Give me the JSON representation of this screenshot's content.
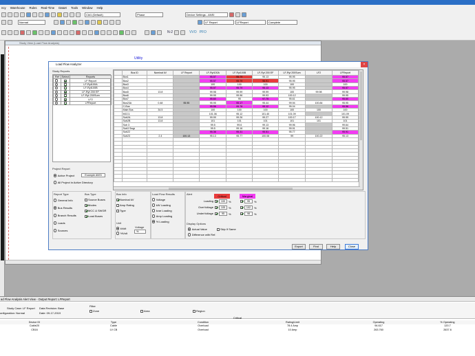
{
  "app": {
    "menu": [
      "ncy",
      "Warehouse",
      "Rules",
      "Real-Time",
      "DataX",
      "Tools",
      "Window",
      "Help"
    ],
    "toolbar": {
      "config_combo": "Ckt1 (Default)",
      "phase_combo": "Phase",
      "standard_combo": "Device Settings - ANSI",
      "normal_combo": "Normal",
      "lf_report_combo": "LF Report",
      "lf_report2_combo": "LFReport",
      "complete_combo": "Complete",
      "n2_label": "N-2",
      "vvo_label": "VVO",
      "pfo_label": "PFO"
    }
  },
  "overview": {
    "title": "Study View (Load Flow Analysis)",
    "utility_label": "Utility"
  },
  "dialog": {
    "title": "Load Flow Analyzer",
    "study_reports": {
      "label": "Study Reports",
      "headers": [
        "Ref",
        "Select",
        "Reports"
      ],
      "rows": [
        {
          "ref": false,
          "select": true,
          "name": "LF Report"
        },
        {
          "ref": false,
          "select": true,
          "name": "LF-Ryt100A"
        },
        {
          "ref": false,
          "select": true,
          "name": "LF-Ryt100B"
        },
        {
          "ref": false,
          "select": true,
          "name": "LF-Ryt 200 EF"
        },
        {
          "ref": false,
          "select": true,
          "name": "LF-Ryt 200Sum"
        },
        {
          "ref": false,
          "select": true,
          "name": "LF2"
        },
        {
          "ref": false,
          "select": true,
          "name": "LFReport"
        }
      ]
    },
    "project_report": {
      "label": "Project Report",
      "active_project": "Active Project",
      "project_name": "Example ANSI",
      "all_projects": "All Project in Active Directory"
    },
    "grid": {
      "headers": [
        "Bus ID",
        "Nominal kV",
        "LF Report",
        "LF-Ryt100A",
        "LF-Ryt100B",
        "LF-Ryt 200 EF",
        "LF-Ryt 200Sum",
        "LF2",
        "LFReport"
      ],
      "rows": [
        {
          "id": "Bus1",
          "kv": "",
          "c": [
            [
              "95.57",
              "pk"
            ],
            [
              "95.79",
              "rd"
            ],
            [
              "95.13",
              ""
            ],
            [
              "95.95",
              ""
            ],
            [
              "",
              ""
            ],
            [
              "95.57",
              "pk"
            ]
          ]
        },
        {
          "id": "Bus2",
          "kv": "",
          "c": [
            [
              "95.57",
              "pk"
            ],
            [
              "95.79",
              "rd"
            ],
            [
              "96.91",
              "rd"
            ],
            [
              "95.95",
              ""
            ],
            [
              "",
              ""
            ],
            [
              "95.57",
              "pk"
            ]
          ]
        },
        {
          "id": "Bus3",
          "kv": "",
          "c": [
            [
              "100",
              ""
            ],
            [
              "100",
              ""
            ],
            [
              "100",
              ""
            ],
            [
              "100",
              ""
            ],
            [
              "",
              ""
            ],
            [
              "100",
              ""
            ]
          ]
        },
        {
          "id": "Bus4",
          "kv": "",
          "c": [
            [
              "95.57",
              "pk"
            ],
            [
              "95.79",
              "pk"
            ],
            [
              "95.13",
              "pk"
            ],
            [
              "95.95",
              ""
            ],
            [
              "",
              ""
            ],
            [
              "95.57",
              "pk"
            ]
          ]
        },
        {
          "id": "Bus5",
          "kv": "13.8",
          "c": [
            [
              "99.98",
              ""
            ],
            [
              "99.99",
              ""
            ],
            [
              "99.99",
              ""
            ],
            [
              "100",
              ""
            ],
            [
              "99.98",
              ""
            ],
            [
              "99.98",
              ""
            ]
          ]
        },
        {
          "id": "Bus6",
          "kv": "",
          "c": [
            [
              "99.95",
              ""
            ],
            [
              "99.96",
              ""
            ],
            [
              "99.93",
              ""
            ],
            [
              "100.12",
              ""
            ],
            [
              "",
              ""
            ],
            [
              "99.95",
              ""
            ]
          ]
        },
        {
          "id": "Bus7",
          "kv": "",
          "c": [
            [
              "95.60",
              "pk"
            ],
            [
              "95",
              ""
            ],
            [
              "97.75",
              "pk"
            ],
            [
              "95.61",
              ""
            ],
            [
              "",
              ""
            ],
            [
              "95.60",
              "pk"
            ]
          ]
        },
        {
          "id": "Bus23A",
          "kv": "0.48",
          "c": [
            [
              "95.95",
              ""
            ],
            [
              "95.17",
              "pk"
            ],
            [
              "95.44",
              ""
            ],
            [
              "99.94",
              ""
            ],
            [
              "100.84",
              ""
            ],
            [
              "95.95",
              ""
            ]
          ]
        },
        {
          "id": "C-Bus",
          "kv": "",
          "c": [
            [
              "95.56",
              "pk"
            ],
            [
              "95.78",
              "pk"
            ],
            [
              "95.12",
              "pk"
            ],
            [
              "95.04",
              ""
            ],
            [
              "",
              ""
            ],
            [
              "95.56",
              "pk"
            ]
          ]
        },
        {
          "id": "Main Bus",
          "kv": "34.5",
          "c": [
            [
              "100",
              ""
            ],
            [
              "100",
              ""
            ],
            [
              "100",
              ""
            ],
            [
              "100",
              ""
            ],
            [
              "100",
              ""
            ],
            [
              "100",
              ""
            ]
          ]
        },
        {
          "id": "MCC1",
          "kv": "",
          "c": [
            [
              "101.06",
              ""
            ],
            [
              "95.12",
              ""
            ],
            [
              "101.40",
              ""
            ],
            [
              "101.09",
              ""
            ],
            [
              "",
              ""
            ],
            [
              "101.09",
              ""
            ]
          ]
        },
        {
          "id": "Sub2A",
          "kv": "13.8",
          "c": [
            [
              "99.99",
              ""
            ],
            [
              "99.26",
              ""
            ],
            [
              "99.27",
              ""
            ],
            [
              "100.17",
              ""
            ],
            [
              "100.12",
              ""
            ],
            [
              "99.99",
              ""
            ]
          ]
        },
        {
          "id": "Sub2B",
          "kv": "13.8",
          "c": [
            [
              "101",
              ""
            ],
            [
              "101",
              ""
            ],
            [
              "101",
              ""
            ],
            [
              "101",
              ""
            ],
            [
              "101",
              ""
            ],
            [
              "101",
              ""
            ]
          ]
        },
        {
          "id": "Sub 3",
          "kv": "",
          "c": [
            [
              "99.5",
              ""
            ],
            [
              "99.6",
              ""
            ],
            [
              "99.13",
              ""
            ],
            [
              "99.96",
              ""
            ],
            [
              "",
              ""
            ],
            [
              "99.64",
              ""
            ]
          ]
        },
        {
          "id": "Sub3 Swgr",
          "kv": "",
          "c": [
            [
              "99.5",
              ""
            ],
            [
              "99.16",
              ""
            ],
            [
              "99.16",
              ""
            ],
            [
              "99.91",
              ""
            ],
            [
              "",
              ""
            ],
            [
              "99.51",
              ""
            ]
          ]
        },
        {
          "id": "Sub22",
          "kv": "",
          "c": [
            [
              "95.36",
              "pk"
            ],
            [
              "95.31",
              "pk"
            ],
            [
              "95.51",
              "pk"
            ],
            [
              "95.77",
              ""
            ],
            [
              "",
              ""
            ],
            [
              "95.91",
              "pk"
            ]
          ]
        },
        {
          "id": "Sub23",
          "kv": "2.4",
          "c": [
            [
              "95.13",
              ""
            ],
            [
              "95.77",
              ""
            ],
            [
              "100.08",
              ""
            ],
            [
              "99",
              ""
            ],
            [
              "100.22",
              ""
            ],
            [
              "95.13",
              ""
            ]
          ]
        }
      ],
      "lfreport_col1": [
        "",
        "",
        "",
        "",
        "",
        "",
        "",
        "95.95",
        "",
        "",
        "",
        "",
        "",
        "",
        "",
        "",
        "100.13"
      ]
    },
    "report_type": {
      "label": "Report Type",
      "options": [
        "General Info",
        "Bus Results",
        "Branch Results",
        "Loads",
        "Sources"
      ],
      "selected": 1
    },
    "bus_type": {
      "label": "Bus Type",
      "options": [
        {
          "name": "Source Buses",
          "on": false
        },
        {
          "name": "Modes",
          "on": true
        },
        {
          "name": "MCC & SWGR",
          "on": true
        },
        {
          "name": "Load Buses",
          "on": true
        }
      ]
    },
    "bus_info": {
      "label": "Bus Info",
      "options": [
        {
          "name": "Nominal kV",
          "on": true
        },
        {
          "name": "Amp Rating",
          "on": false
        },
        {
          "name": "Type",
          "on": false
        }
      ]
    },
    "unit": {
      "label": "Unit",
      "options": [
        "kVolt",
        "%Volt"
      ],
      "selected": 0,
      "voltage_label": "Voltage",
      "voltage_value": "%"
    },
    "load_flow_results": {
      "label": "Load Flow Results",
      "options": [
        "Voltage",
        "kW Loading",
        "kvar Loading",
        "Amp Loading",
        "% Loading"
      ],
      "selected": 4
    },
    "alert": {
      "label": "Alert",
      "critical_label": "Critical",
      "marginal_label": "Marginal",
      "critical_color": "#e83b3b",
      "marginal_color": "#f23cf2",
      "rows": [
        {
          "name": "Loading",
          "crit_on": true,
          "crit": "100",
          "mar_on": true,
          "mar": "95"
        },
        {
          "name": "OverVoltage",
          "crit_on": true,
          "crit": "105",
          "mar_on": true,
          "mar": "102"
        },
        {
          "name": "UnderVoltage",
          "crit_on": true,
          "crit": "95",
          "mar_on": true,
          "mar": "98"
        }
      ],
      "percent": "%"
    },
    "display_options": {
      "label": "Display Options",
      "actual_value": "Actual Value",
      "skip_if_same": "Skip If Same",
      "difference": "Difference with Ref."
    },
    "buttons": {
      "export": "Export",
      "find": "Find",
      "help": "Help",
      "close": "Close"
    }
  },
  "alert_view": {
    "title": "ad Flow Analysis Alert View - Output Report: LFReport",
    "study_case": "Study Case: LF Report",
    "data_revision": "Data Revision: Base",
    "configuration": "onfiguration: Normal",
    "date": "Date: 09-17-2019",
    "filter_label": "Filter",
    "filter_options": [
      "Zone",
      "Area",
      "Region"
    ],
    "critical_label": "Critical",
    "headers": [
      "Device ID",
      "Type",
      "Condition",
      "Rating/Limit",
      "Operating",
      "% Operating"
    ],
    "rows": [
      [
        "Cable20",
        "Cable",
        "Overload",
        "78.4 Amp",
        "94.617",
        "120.7"
      ],
      [
        "CB16",
        "LV CB",
        "Overload",
        "10 Amp",
        "263.760",
        "2637.6"
      ]
    ]
  }
}
